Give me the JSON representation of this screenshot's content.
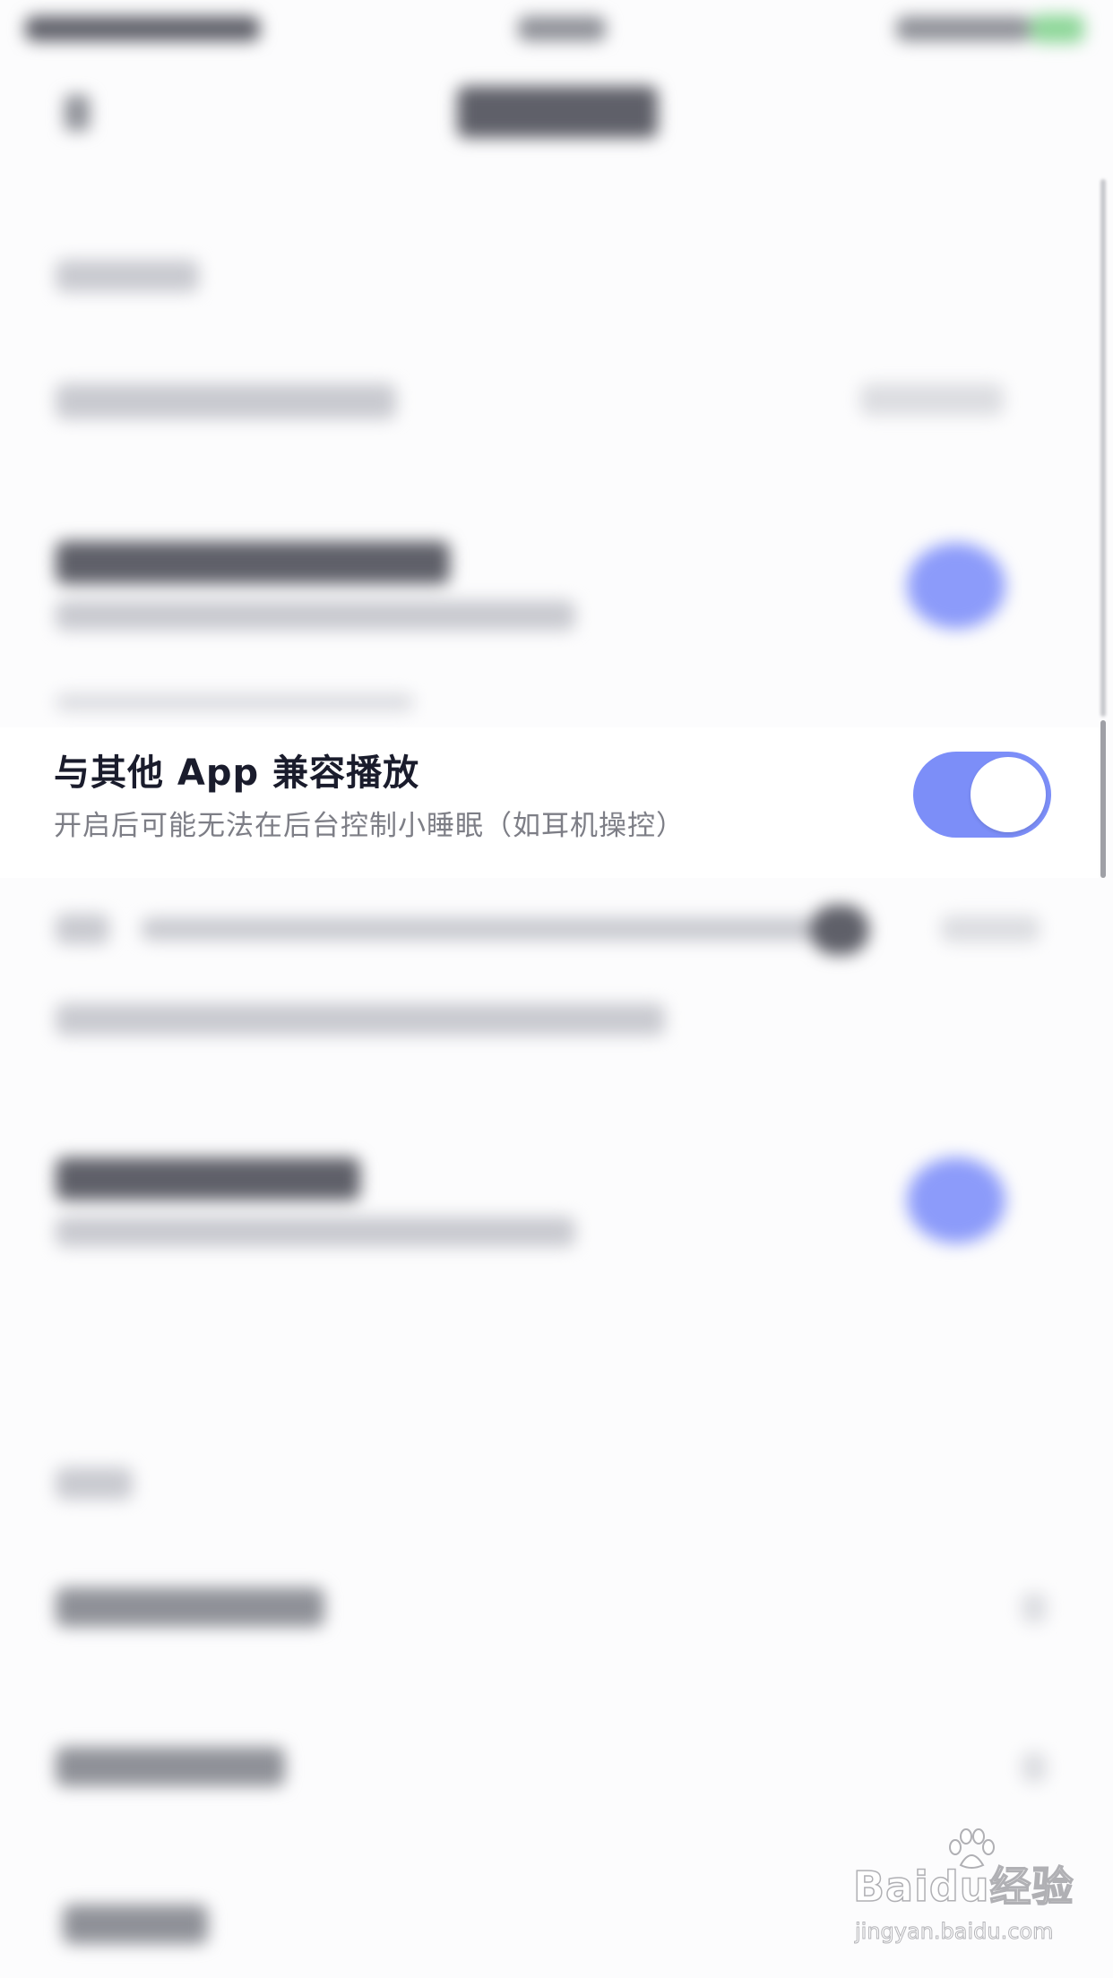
{
  "settings_row": {
    "title": "与其他 App 兼容播放",
    "subtitle": "开启后可能无法在后台控制小睡眠（如耳机操控）",
    "toggle_on": true
  },
  "colors": {
    "accent": "#7c8ef8",
    "title_text": "#1a1c2c",
    "subtitle_text": "#7d7e86",
    "background": "#fcfcfd"
  },
  "watermark": {
    "logo_text": "Baidu经验",
    "url": "jingyan.baidu.com"
  }
}
